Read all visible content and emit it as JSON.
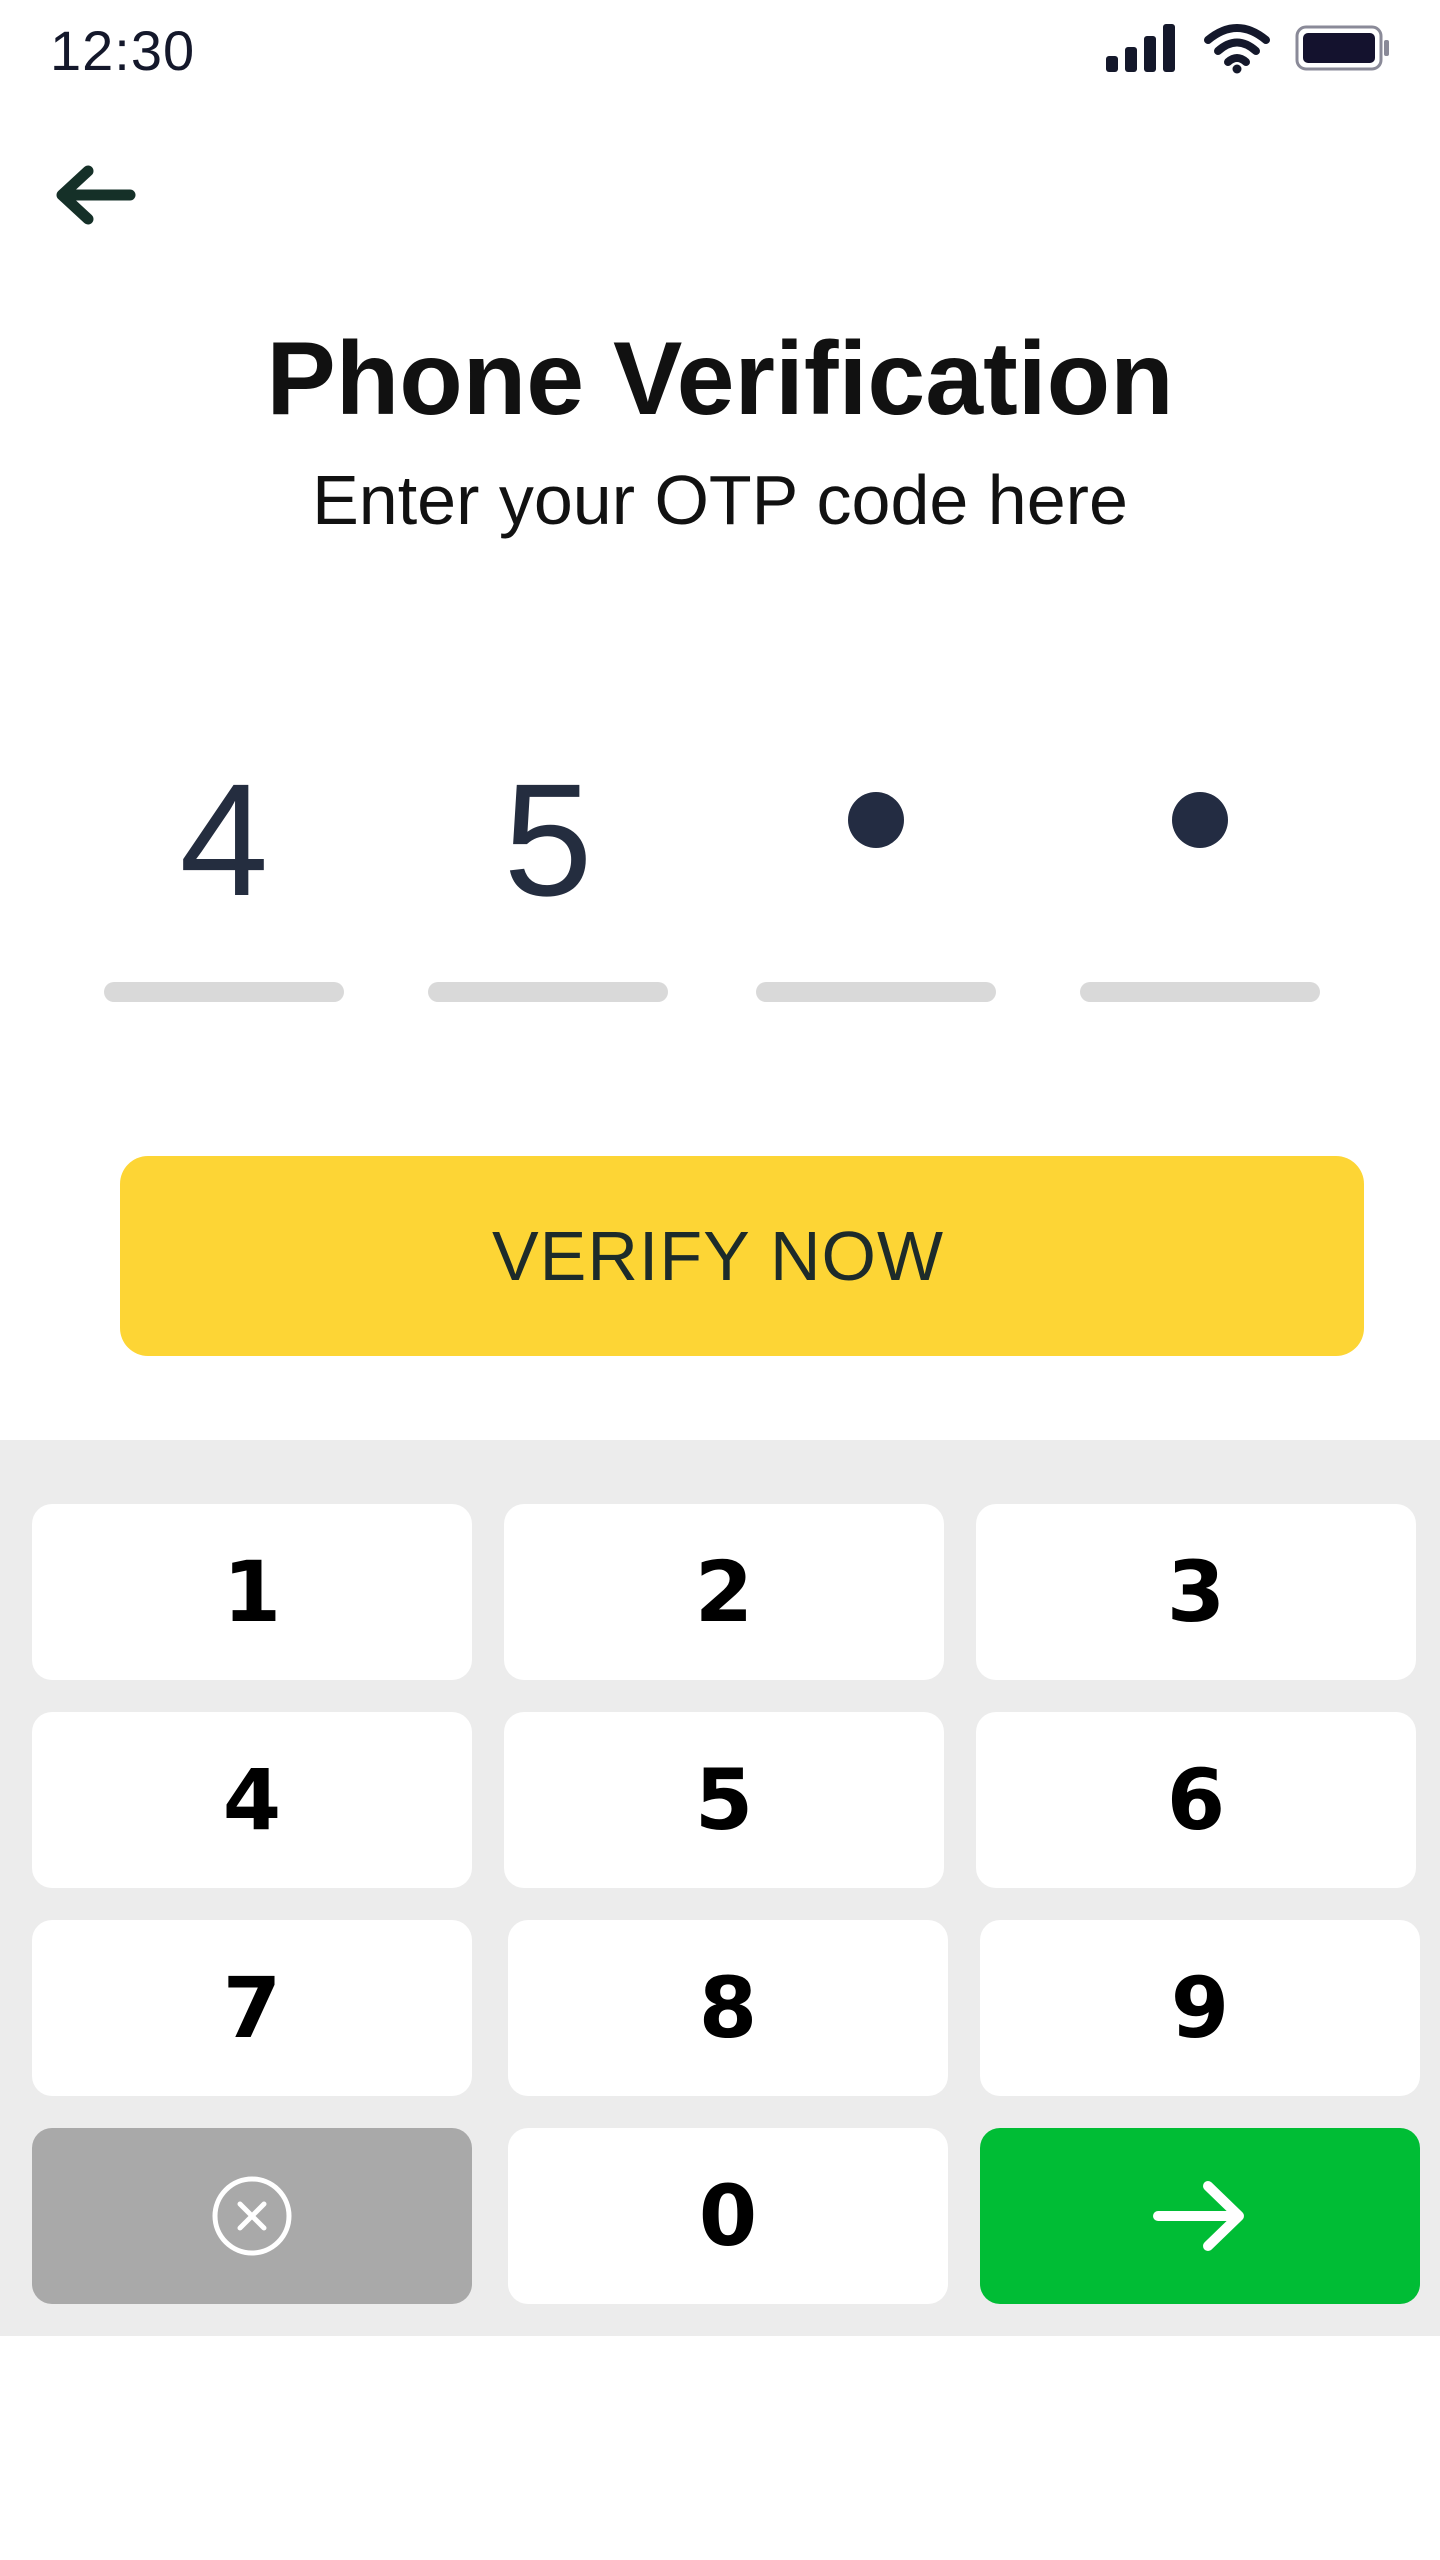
{
  "status_bar": {
    "time": "12:30",
    "icons": [
      "signal-icon",
      "wifi-icon",
      "battery-icon"
    ]
  },
  "header": {
    "back_icon": "arrow-left-icon",
    "title": "Phone Verification",
    "subtitle": "Enter your OTP code here"
  },
  "otp": {
    "digits": [
      "4",
      "5",
      "",
      ""
    ],
    "filled_count": 2,
    "total": 4
  },
  "verify_button": {
    "label": "VERIFY NOW"
  },
  "keypad": {
    "keys": [
      "1",
      "2",
      "3",
      "4",
      "5",
      "6",
      "7",
      "8",
      "9",
      "0"
    ],
    "delete_icon": "clear-circle-x-icon",
    "submit_icon": "arrow-right-icon"
  },
  "colors": {
    "accent_yellow": "#FDD535",
    "submit_green": "#00BD35",
    "delete_gray": "#A9A9A9",
    "keypad_background": "#ECECEC",
    "digit_color": "#242D3F"
  }
}
